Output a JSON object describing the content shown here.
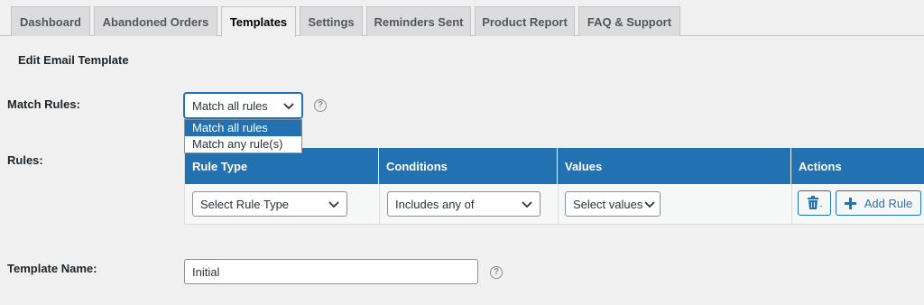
{
  "tabs": [
    {
      "label": "Dashboard"
    },
    {
      "label": "Abandoned Orders"
    },
    {
      "label": "Templates"
    },
    {
      "label": "Settings"
    },
    {
      "label": "Reminders Sent"
    },
    {
      "label": "Product Report"
    },
    {
      "label": "FAQ & Support"
    }
  ],
  "active_tab": "Templates",
  "page_title": "Edit Email Template",
  "match_rules": {
    "label": "Match Rules:",
    "selected": "Match all rules",
    "options": [
      "Match all rules",
      "Match any rule(s)"
    ]
  },
  "rules": {
    "label": "Rules:",
    "columns": [
      "Rule Type",
      "Conditions",
      "Values",
      "Actions"
    ],
    "row": {
      "rule_type": "Select Rule Type",
      "condition": "Includes any of",
      "values": "Select values",
      "add_rule_label": "Add Rule"
    }
  },
  "template_name": {
    "label": "Template Name:",
    "value": "Initial"
  },
  "colors": {
    "accent": "#2271b1",
    "background": "#f0f0f1"
  },
  "icons": {
    "help": "question-circle-icon",
    "delete": "trash-icon",
    "add": "plus-icon",
    "dropdown": "chevron-down-icon"
  }
}
